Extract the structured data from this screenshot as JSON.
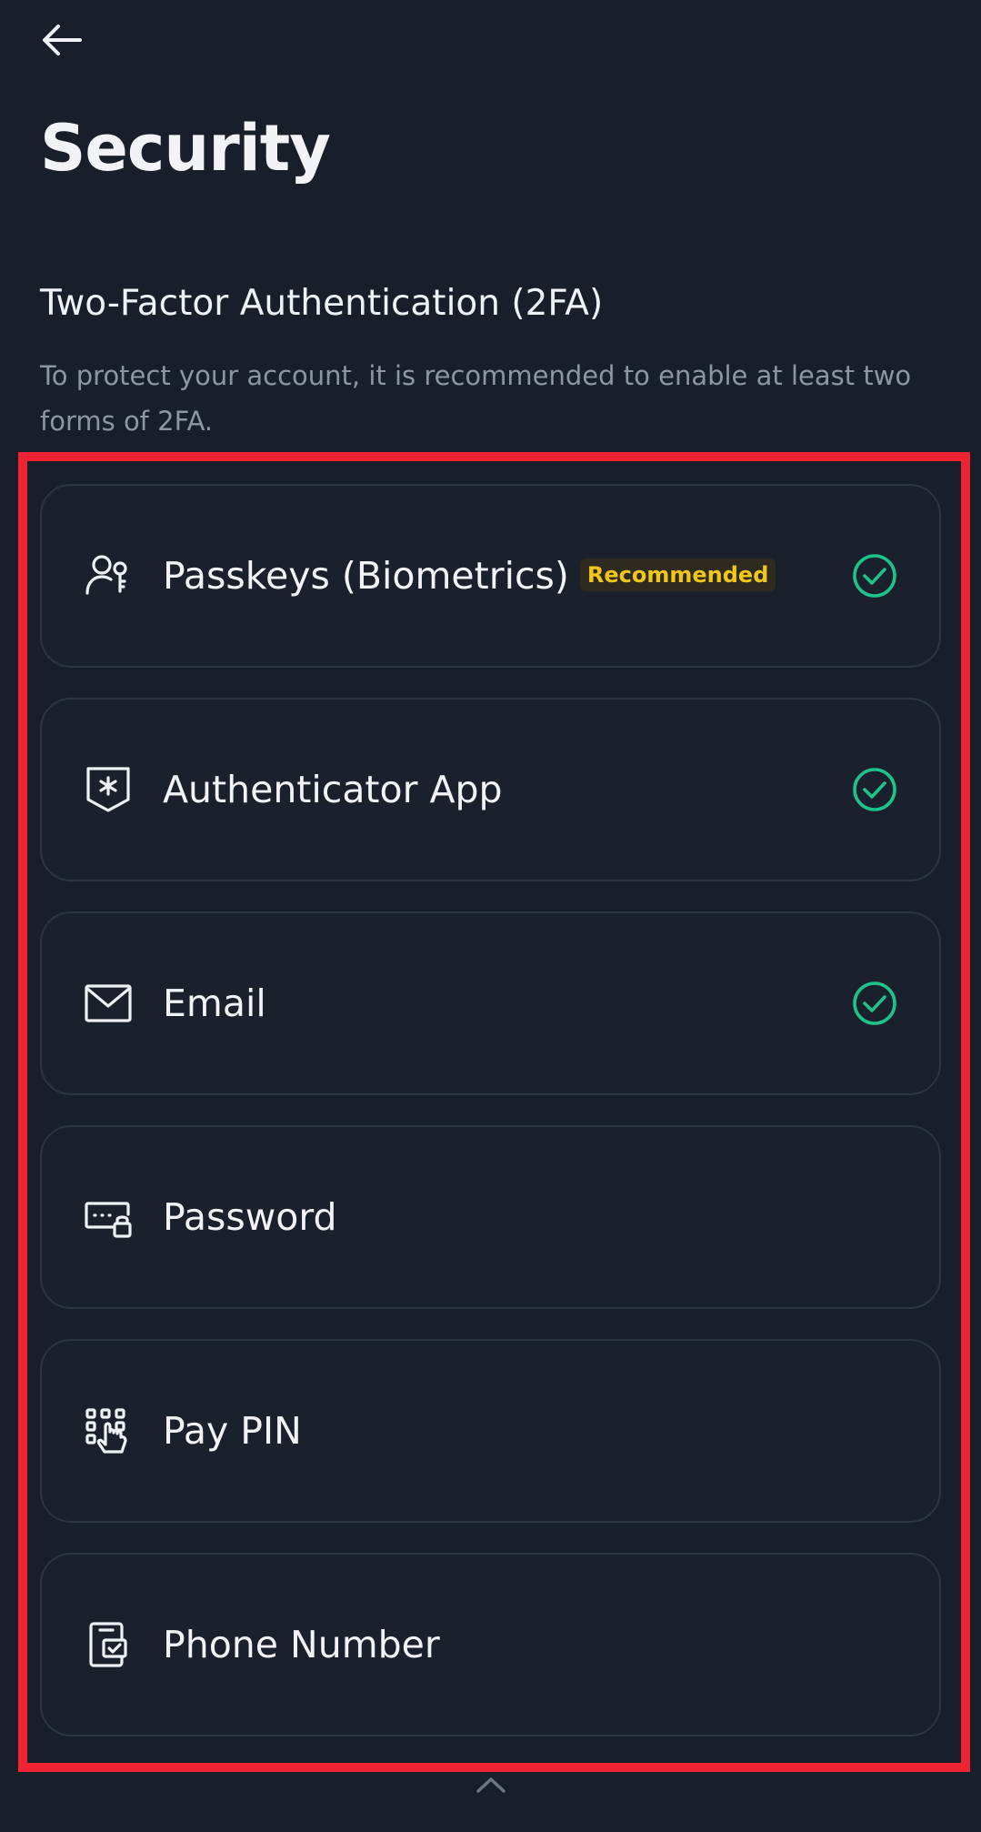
{
  "header": {
    "back_icon": "arrow-left-icon",
    "title": "Security"
  },
  "section": {
    "title": "Two-Factor Authentication (2FA)",
    "description": "To protect your account, it is recommended to enable at least two forms of 2FA."
  },
  "methods": [
    {
      "label": "Passkeys (Biometrics)",
      "badge": "Recommended",
      "icon": "passkey-person-icon",
      "enabled": true
    },
    {
      "label": "Authenticator App",
      "icon": "shield-asterisk-icon",
      "enabled": true
    },
    {
      "label": "Email",
      "icon": "envelope-icon",
      "enabled": true
    },
    {
      "label": "Password",
      "icon": "password-lock-icon",
      "enabled": false
    },
    {
      "label": "Pay PIN",
      "icon": "keypad-touch-icon",
      "enabled": false
    },
    {
      "label": "Phone Number",
      "icon": "phone-check-icon",
      "enabled": false
    }
  ],
  "colors": {
    "background": "#181f2b",
    "card_border": "#2c3543",
    "check_green": "#1ec28b",
    "badge_text": "#f2c618",
    "highlight": "#ee2432"
  },
  "footer": {
    "scroll_icon": "chevron-up-icon"
  }
}
